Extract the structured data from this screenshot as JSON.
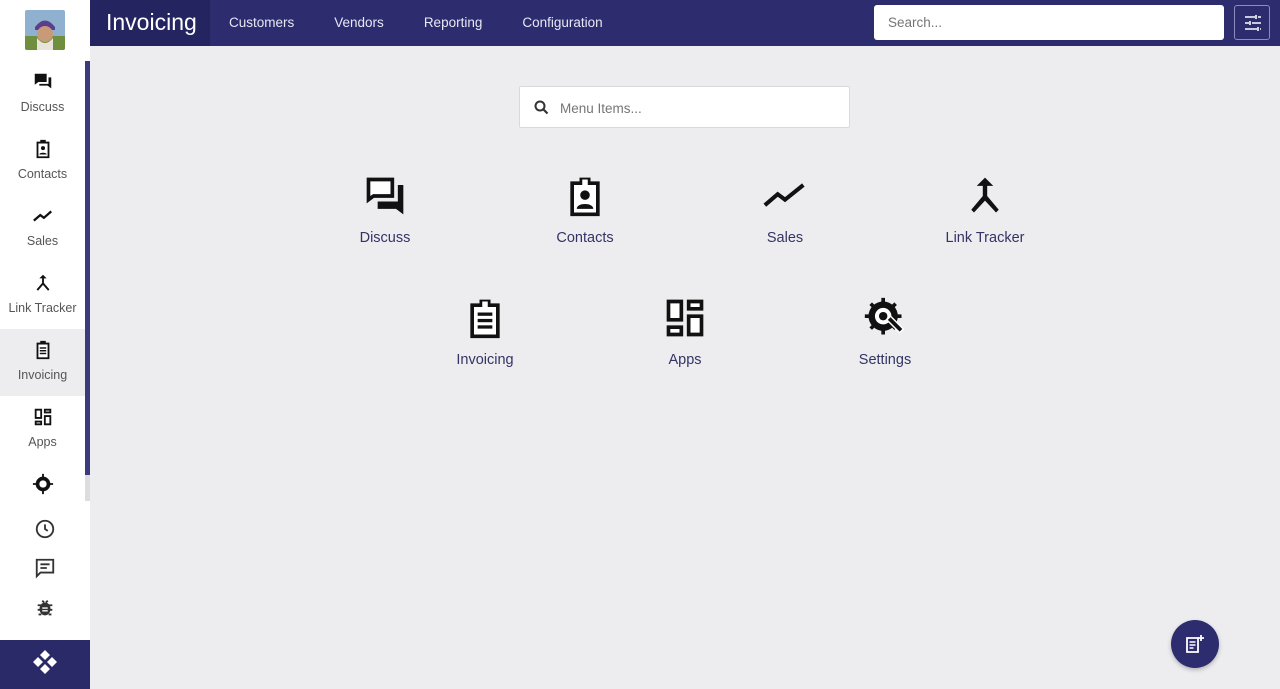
{
  "topbar": {
    "app_title": "Invoicing",
    "nav": [
      "Customers",
      "Vendors",
      "Reporting",
      "Configuration"
    ],
    "search_placeholder": "Search..."
  },
  "sidebar": {
    "items": [
      {
        "label": "Discuss",
        "icon": "chat-icon"
      },
      {
        "label": "Contacts",
        "icon": "contact-badge-icon"
      },
      {
        "label": "Sales",
        "icon": "trend-line-icon"
      },
      {
        "label": "Link Tracker",
        "icon": "merge-arrow-icon"
      },
      {
        "label": "Invoicing",
        "icon": "clipboard-list-icon",
        "active": true
      },
      {
        "label": "Apps",
        "icon": "dashboard-grid-icon"
      }
    ]
  },
  "menu_search": {
    "placeholder": "Menu Items..."
  },
  "apps": [
    {
      "label": "Discuss",
      "icon": "chat-icon"
    },
    {
      "label": "Contacts",
      "icon": "contact-badge-icon"
    },
    {
      "label": "Sales",
      "icon": "trend-line-icon"
    },
    {
      "label": "Link Tracker",
      "icon": "merge-arrow-icon"
    },
    {
      "label": "Invoicing",
      "icon": "clipboard-list-icon"
    },
    {
      "label": "Apps",
      "icon": "dashboard-grid-icon"
    },
    {
      "label": "Settings",
      "icon": "gear-wrench-icon"
    }
  ],
  "colors": {
    "brand": "#2c2c6e",
    "brand_dark": "#242460",
    "background": "#ededf0",
    "app_label": "#333366"
  }
}
